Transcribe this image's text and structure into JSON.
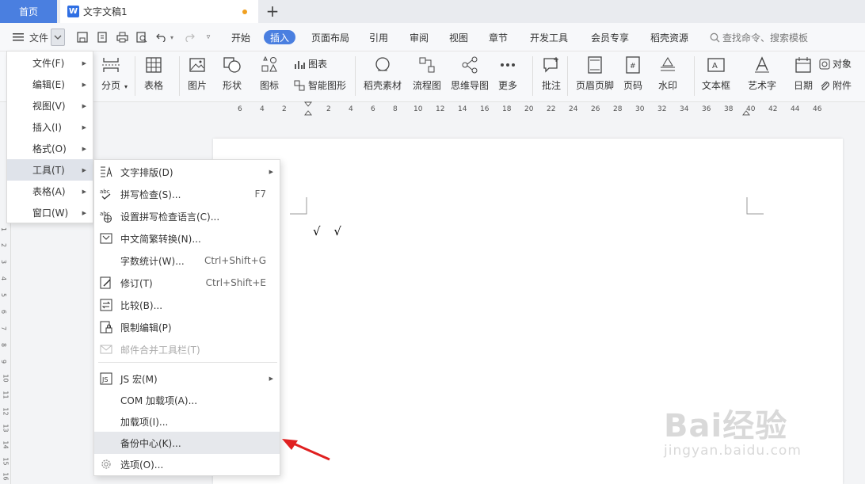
{
  "titlebar": {
    "home_tab": "首页",
    "doc_tab": "文字文稿1",
    "doc_icon_letter": "W",
    "add_tab": "+"
  },
  "menubar": {
    "file_label": "文件",
    "tabs": [
      "开始",
      "插入",
      "页面布局",
      "引用",
      "审阅",
      "视图",
      "章节",
      "开发工具",
      "会员专享",
      "稻壳资源"
    ],
    "active_tab": "插入",
    "search": "查找命令、搜索模板"
  },
  "ribbon": {
    "items": {
      "page_break": "分页",
      "table": "表格",
      "picture": "图片",
      "shape": "形状",
      "icon": "图标",
      "chart": "图表",
      "smart_shape": "智能图形",
      "material": "稻壳素材",
      "flowchart": "流程图",
      "mindmap": "思维导图",
      "more": "更多",
      "comment": "批注",
      "header_footer": "页眉页脚",
      "page_number": "页码",
      "watermark": "水印",
      "textbox": "文本框",
      "wordart": "艺术字",
      "date": "日期",
      "object": "对象",
      "attachment": "附件"
    }
  },
  "ruler": {
    "labels": [
      "6",
      "4",
      "2",
      "2",
      "4",
      "6",
      "8",
      "10",
      "12",
      "14",
      "16",
      "18",
      "20",
      "22",
      "24",
      "26",
      "28",
      "30",
      "32",
      "34",
      "36",
      "38",
      "40",
      "42",
      "44",
      "46"
    ]
  },
  "vruler": {
    "labels": [
      "1",
      "2",
      "3",
      "4",
      "5",
      "6",
      "7",
      "8",
      "9",
      "10",
      "11",
      "12",
      "13",
      "14",
      "15",
      "16"
    ]
  },
  "document": {
    "content": "√ √"
  },
  "file_menu": {
    "items": [
      {
        "label": "文件(F)"
      },
      {
        "label": "编辑(E)"
      },
      {
        "label": "视图(V)"
      },
      {
        "label": "插入(I)"
      },
      {
        "label": "格式(O)"
      },
      {
        "label": "工具(T)"
      },
      {
        "label": "表格(A)"
      },
      {
        "label": "窗口(W)"
      }
    ],
    "active": "工具(T)"
  },
  "tools_menu": {
    "items": [
      {
        "label": "文字排版(D)",
        "shortcut": ""
      },
      {
        "label": "拼写检查(S)...",
        "shortcut": "F7"
      },
      {
        "label": "设置拼写检查语言(C)...",
        "shortcut": ""
      },
      {
        "label": "中文简繁转换(N)...",
        "shortcut": ""
      },
      {
        "label": "字数统计(W)...",
        "shortcut": "Ctrl+Shift+G"
      },
      {
        "label": "修订(T)",
        "shortcut": "Ctrl+Shift+E"
      },
      {
        "label": "比较(B)...",
        "shortcut": ""
      },
      {
        "label": "限制编辑(P)",
        "shortcut": ""
      },
      {
        "label": "邮件合并工具栏(T)",
        "shortcut": ""
      },
      {
        "label": "JS 宏(M)",
        "shortcut": ""
      },
      {
        "label": "COM 加载项(A)...",
        "shortcut": ""
      },
      {
        "label": "加载项(I)...",
        "shortcut": ""
      },
      {
        "label": "备份中心(K)...",
        "shortcut": ""
      },
      {
        "label": "选项(O)...",
        "shortcut": ""
      }
    ],
    "highlighted": "备份中心(K)..."
  },
  "colors": {
    "accent": "#4a7fe0",
    "arrow": "#e02020"
  },
  "watermark": {
    "brand": "Bai经验",
    "url": "jingyan.baidu.com"
  }
}
